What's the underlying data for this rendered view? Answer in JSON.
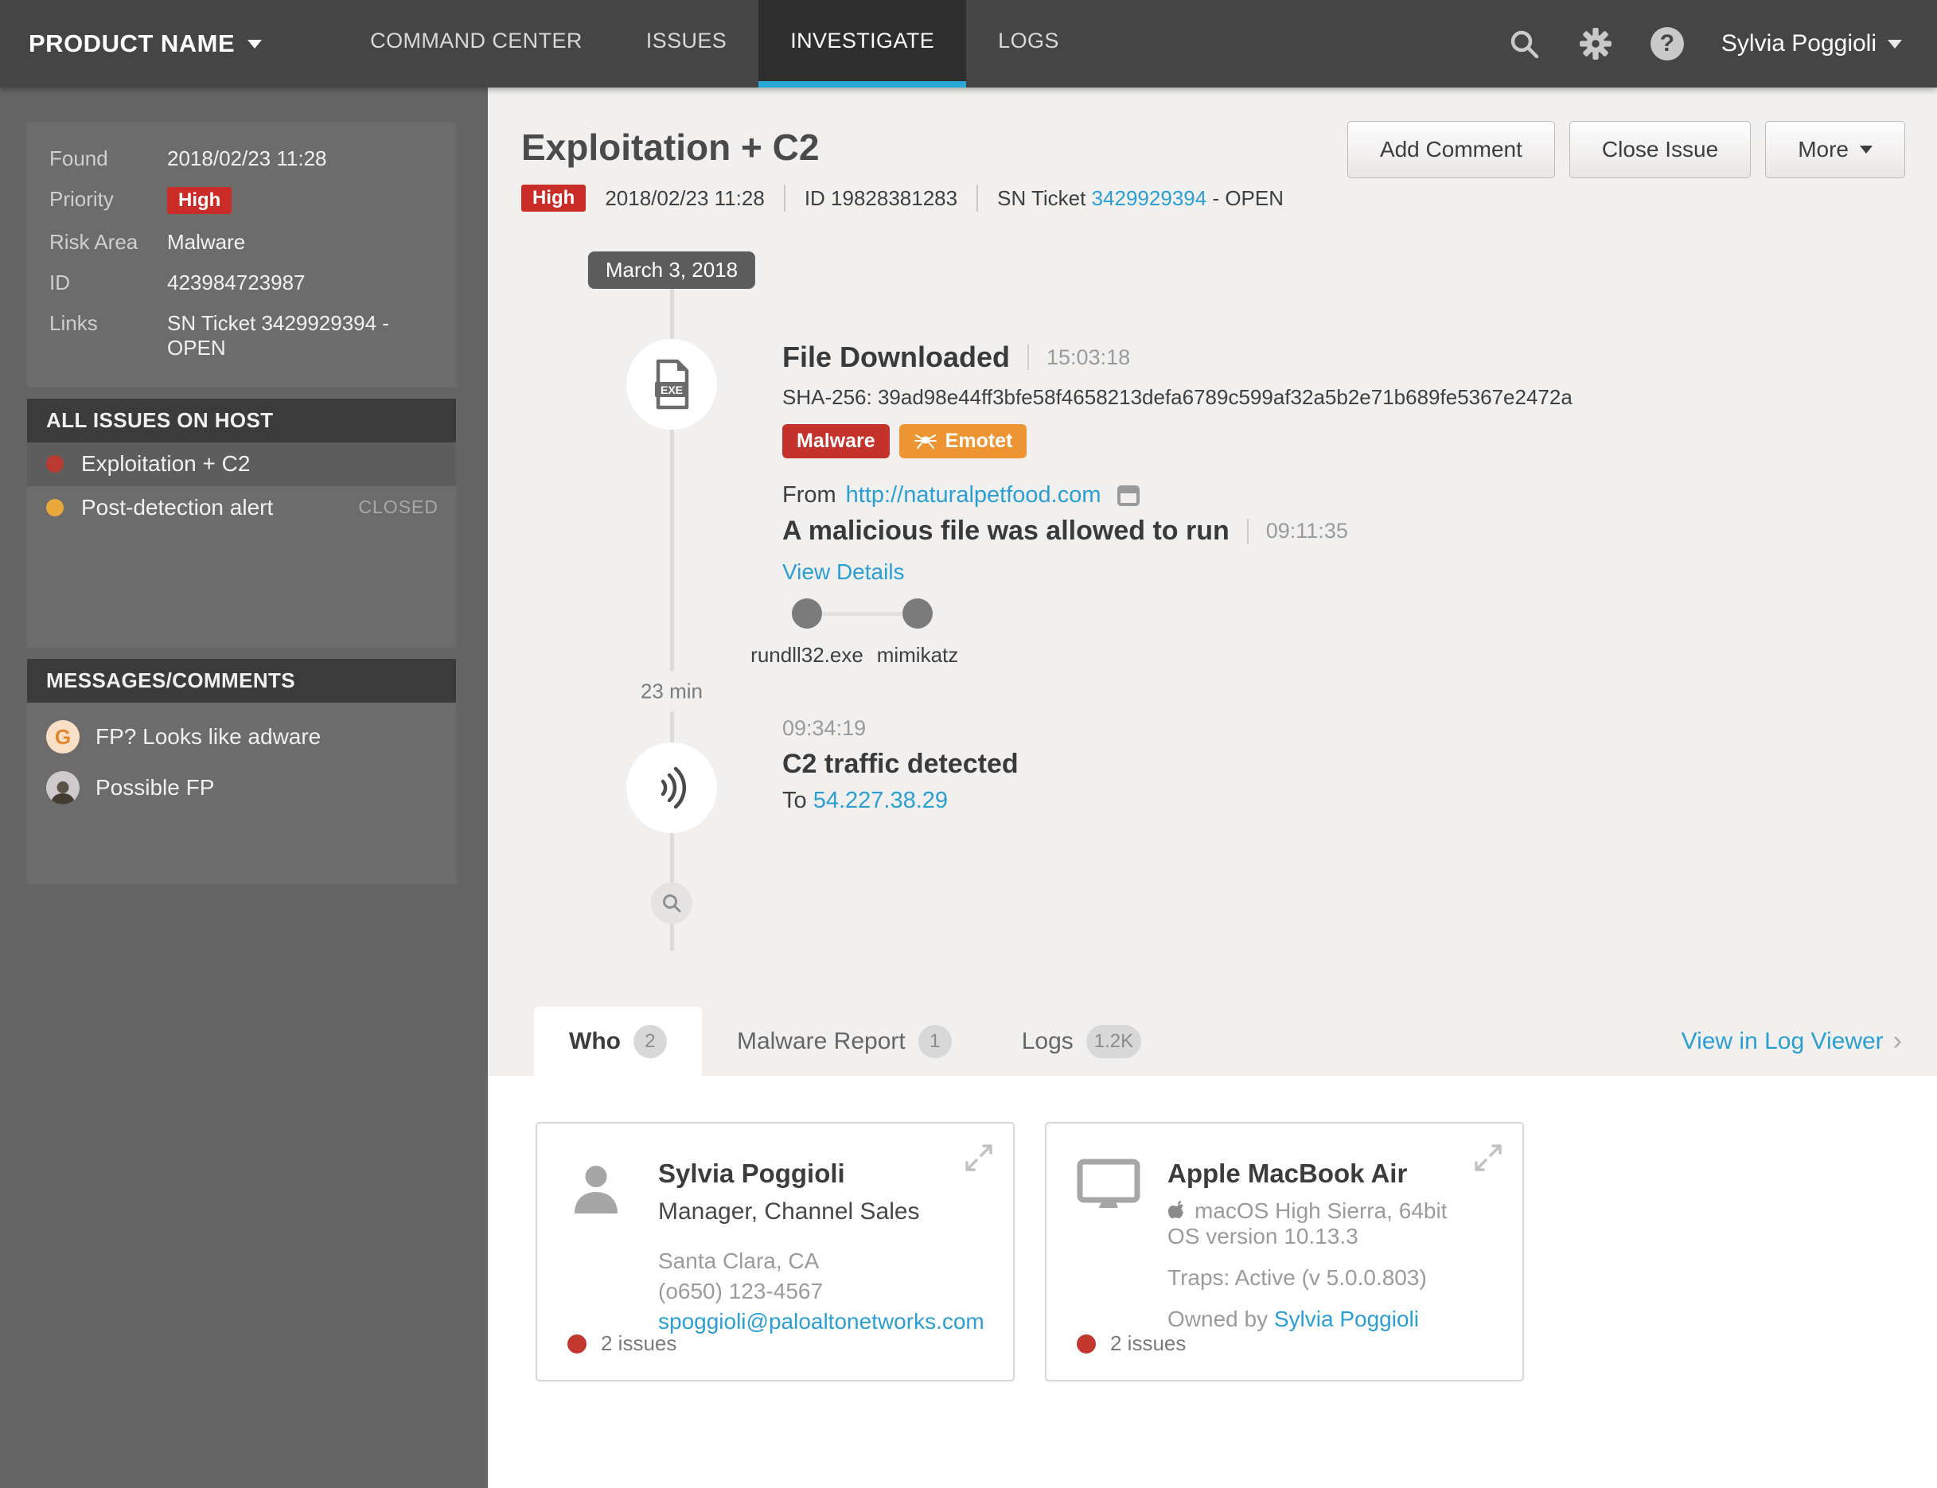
{
  "nav": {
    "product_name": "PRODUCT NAME",
    "items": [
      {
        "label": "COMMAND CENTER",
        "active": false
      },
      {
        "label": "ISSUES",
        "active": false
      },
      {
        "label": "INVESTIGATE",
        "active": true
      },
      {
        "label": "LOGS",
        "active": false
      }
    ],
    "user_name": "Sylvia Poggioli"
  },
  "sidebar": {
    "details": {
      "rows": [
        {
          "label": "Found",
          "value": "2018/02/23 11:28"
        },
        {
          "label": "Priority",
          "value": "High"
        },
        {
          "label": "Risk Area",
          "value": "Malware"
        },
        {
          "label": "ID",
          "value": "423984723987"
        },
        {
          "label": "Links",
          "value": "SN Ticket 3429929394 - OPEN"
        }
      ]
    },
    "all_issues": {
      "title": "ALL ISSUES ON HOST",
      "items": [
        {
          "label": "Exploitation + C2",
          "status": "",
          "dot_color": "#bb3a31"
        },
        {
          "label": "Post-detection alert",
          "status": "CLOSED",
          "dot_color": "#e9a73c"
        }
      ]
    },
    "messages": {
      "title": "MESSAGES/COMMENTS",
      "items": [
        {
          "avatar": "G",
          "text": "FP? Looks like adware"
        },
        {
          "avatar": "photo",
          "text": "Possible FP"
        }
      ]
    }
  },
  "main": {
    "title": "Exploitation + C2",
    "meta": {
      "priority": "High",
      "date": "2018/02/23 11:28",
      "id": "ID 19828381283",
      "sn_label": "SN Ticket",
      "sn_link": "3429929394",
      "sn_suffix": "- OPEN"
    },
    "actions": {
      "add_comment": "Add Comment",
      "close_issue": "Close Issue",
      "more": "More"
    },
    "timeline": {
      "date_tag": "March 3, 2018",
      "event1": {
        "title": "File Downloaded",
        "time": "15:03:18",
        "sha": "SHA-256: 39ad98e44ff3bfe58f4658213defa6789c599af32a5b2e71b689fe5367e2472a",
        "badge_malware": "Malware",
        "badge_emotet": "Emotet",
        "from_label": "From",
        "from_url": "http://naturalpetfood.com"
      },
      "event2": {
        "title": "A malicious file was allowed to run",
        "time": "09:11:35",
        "details_link": "View Details",
        "process1": "rundll32.exe",
        "process2": "mimikatz"
      },
      "gap_label": "23 min",
      "event3": {
        "time": "09:34:19",
        "title": "C2 traffic detected",
        "to_label": "To",
        "to_ip": "54.227.38.29"
      }
    },
    "tabs": [
      {
        "label": "Who",
        "count": "2",
        "active": true
      },
      {
        "label": "Malware Report",
        "count": "1",
        "active": false
      },
      {
        "label": "Logs",
        "count": "1.2K",
        "active": false
      }
    ],
    "log_viewer_link": "View in Log Viewer",
    "cards": [
      {
        "type": "person",
        "name": "Sylvia Poggioli",
        "role": "Manager, Channel Sales",
        "location": "Santa Clara, CA",
        "phone": "(o650) 123-4567",
        "email": "spoggioli@paloaltonetworks.com",
        "issues": "2 issues"
      },
      {
        "type": "device",
        "name": "Apple MacBook Air",
        "os": "macOS High Sierra, 64bit",
        "os_version": "OS version 10.13.3",
        "traps": "Traps: Active (v 5.0.0.803)",
        "owned_by_label": "Owned by",
        "owner": "Sylvia Poggioli",
        "issues": "2 issues"
      }
    ]
  },
  "icons": {
    "search": "magnifier",
    "settings": "gear",
    "help": "question-circle",
    "menu_carets": "chevron-down",
    "exe_file": "exe-document",
    "network": "signal-waves",
    "timeline_zoom": "magnifier-small",
    "external_page": "browser-window",
    "emotet": "spider",
    "expand": "diagonal-arrows",
    "person": "person-silhouette",
    "device": "monitor",
    "apple": "apple-logo"
  },
  "colors": {
    "accent_blue": "#2b9fd3",
    "priority_red": "#ca2d27",
    "emotet_orange": "#ee9533",
    "nav_underline_cyan": "#29a9d6",
    "nav_bg": "#454545",
    "sidebar_bg": "#656565",
    "main_bg": "#f1f0ee"
  }
}
